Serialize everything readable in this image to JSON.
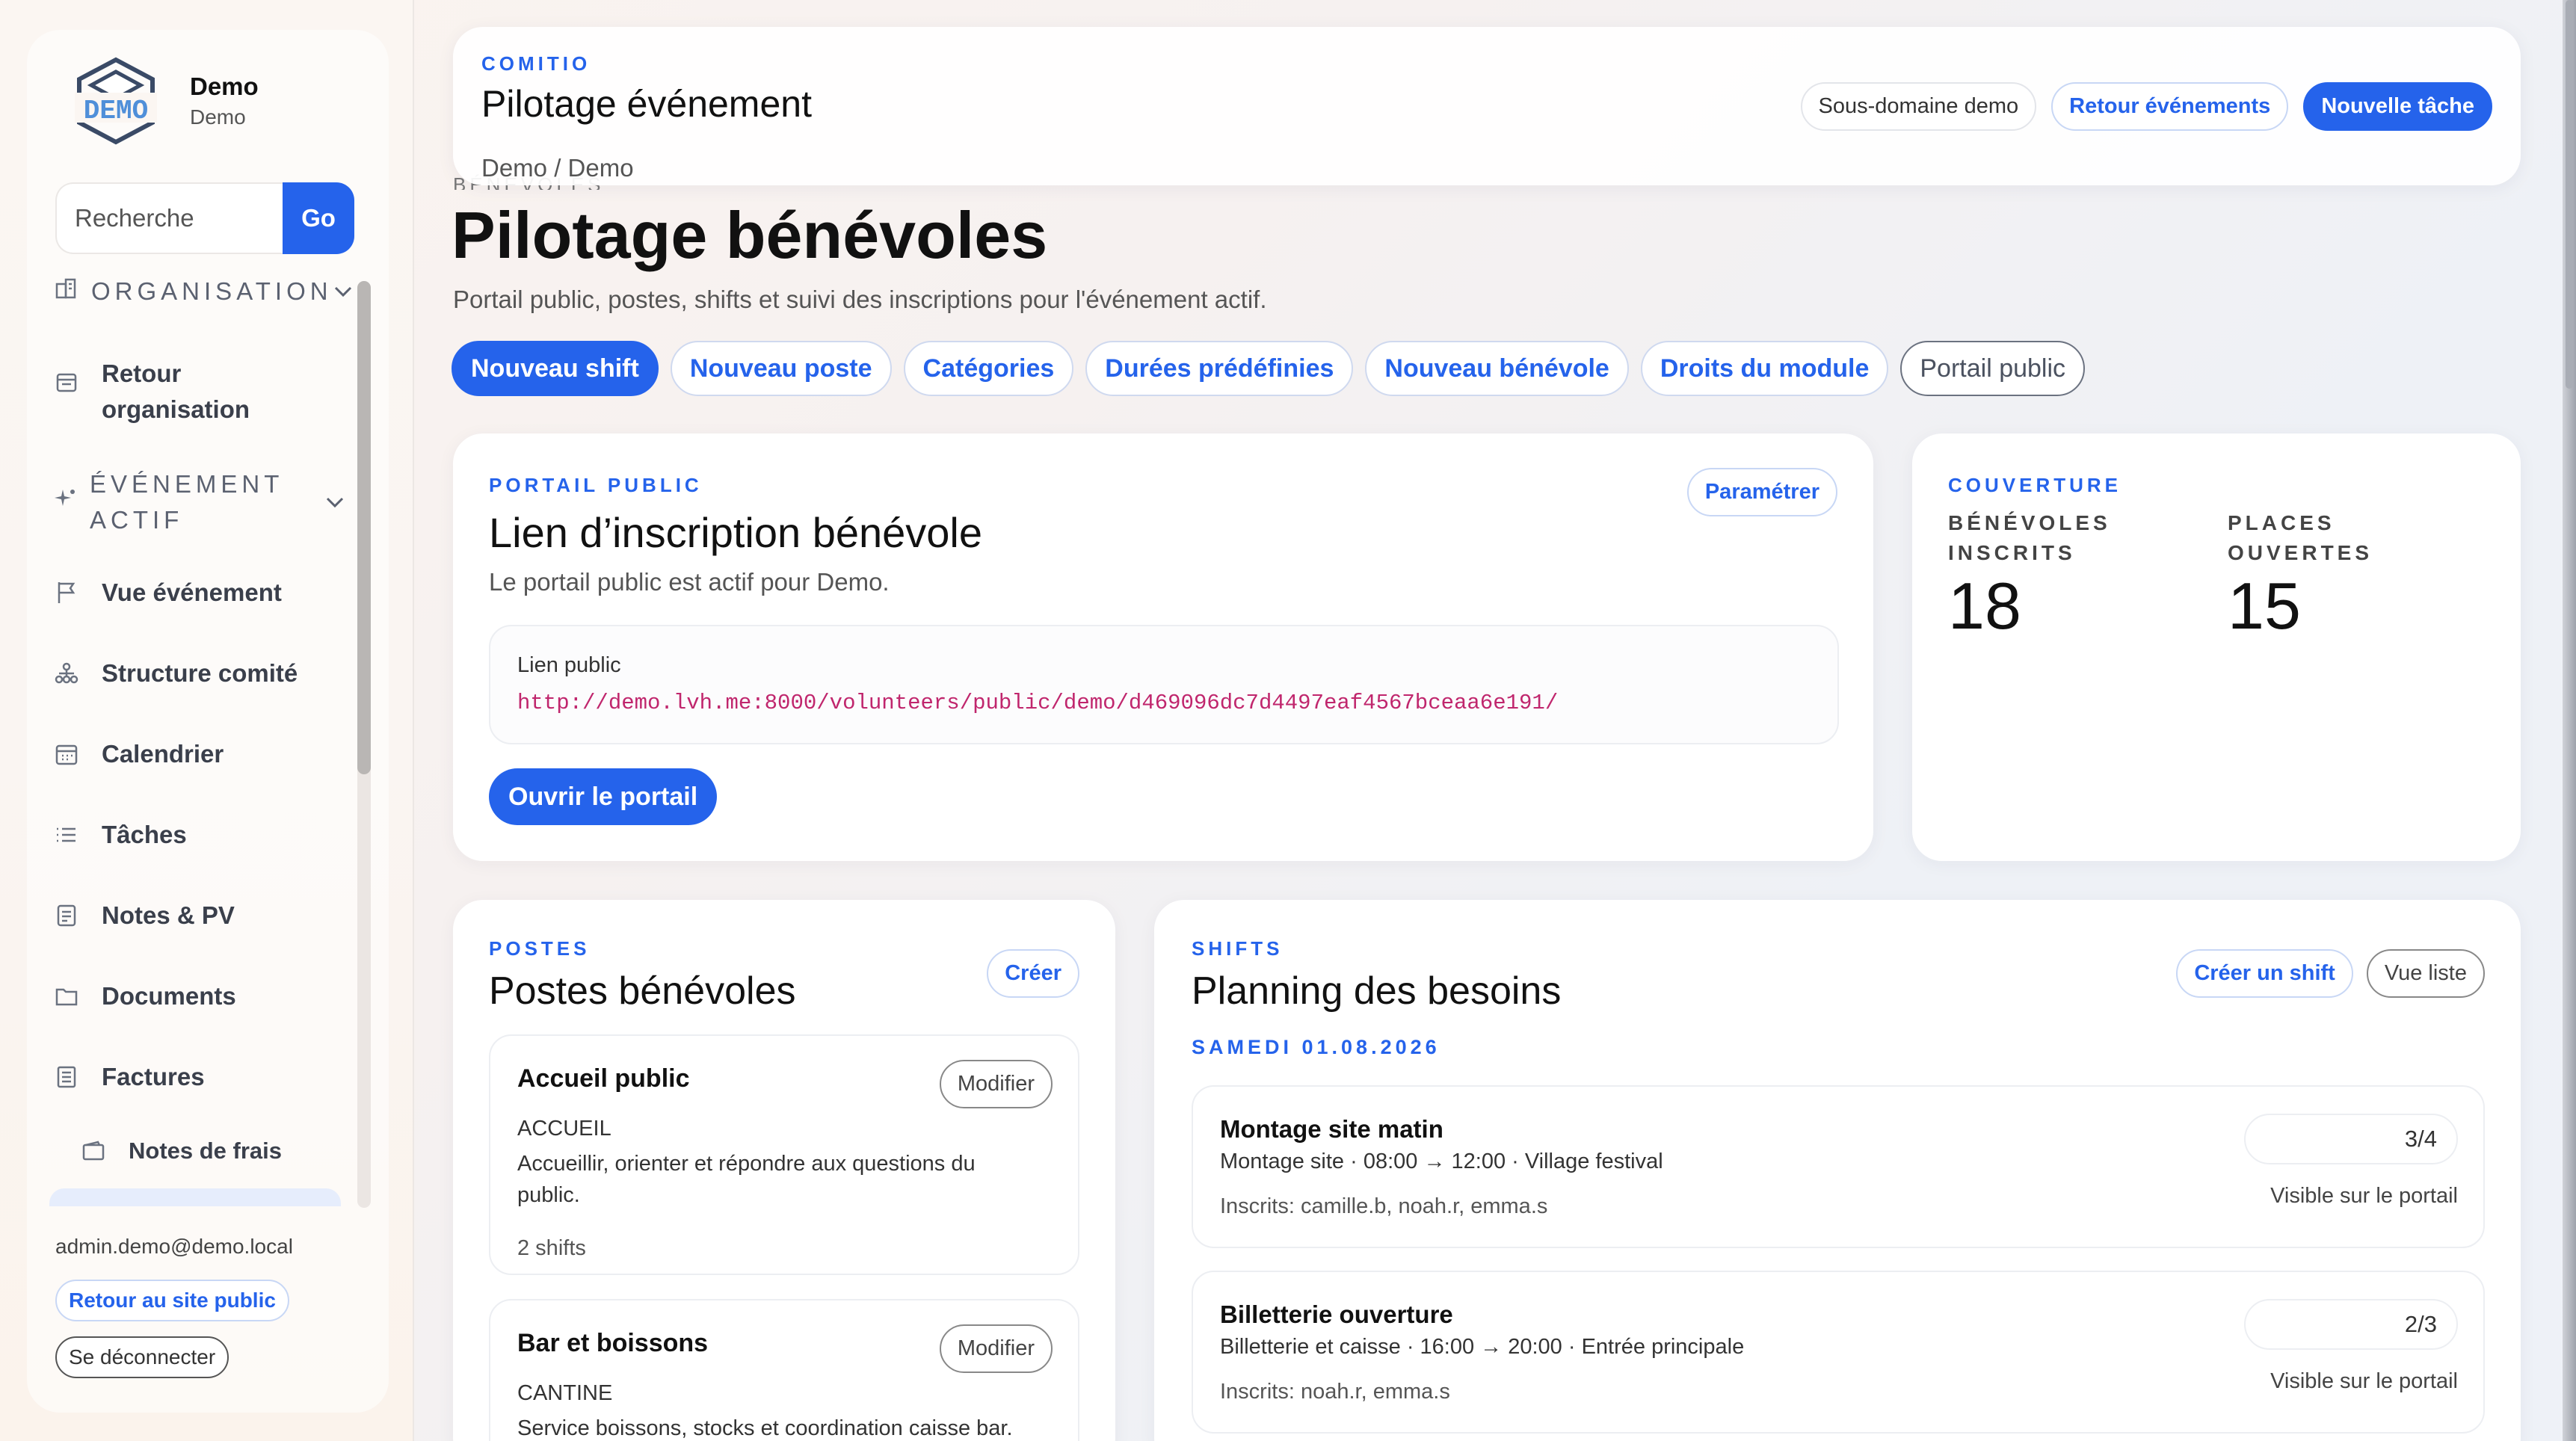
{
  "brand": {
    "name": "Demo",
    "sub": "Demo",
    "logo_text": "DEMO"
  },
  "search": {
    "placeholder": "Recherche",
    "button": "Go"
  },
  "sidebar": {
    "section_org": "ORGANISATION",
    "item_retour": "Retour organisation",
    "section_event": "ÉVÉNEMENT ACTIF",
    "items": [
      {
        "label": "Vue événement",
        "icon": "flag-icon"
      },
      {
        "label": "Structure comité",
        "icon": "org-chart-icon"
      },
      {
        "label": "Calendrier",
        "icon": "calendar-icon"
      },
      {
        "label": "Tâches",
        "icon": "list-icon"
      },
      {
        "label": "Notes & PV",
        "icon": "notes-icon"
      },
      {
        "label": "Documents",
        "icon": "folder-icon"
      },
      {
        "label": "Factures",
        "icon": "invoice-icon"
      }
    ],
    "subitem": "Notes de frais",
    "user_email": "admin.demo@demo.local",
    "back_public": "Retour au site public",
    "logout": "Se déconnecter"
  },
  "header": {
    "eyebrow": "COMITIO",
    "title": "Pilotage événement",
    "crumbs": "Demo / Demo",
    "subdomain": "Sous-domaine demo",
    "back_events": "Retour événements",
    "new_task": "Nouvelle tâche"
  },
  "page": {
    "hidden_eyebrow": "BÉNÉVOLES",
    "title": "Pilotage bénévoles",
    "subtitle": "Portail public, postes, shifts et suivi des inscriptions pour l'événement actif."
  },
  "tabs": {
    "new_shift": "Nouveau shift",
    "new_poste": "Nouveau poste",
    "categories": "Catégories",
    "durations": "Durées prédéfinies",
    "new_volunteer": "Nouveau bénévole",
    "rights": "Droits du module",
    "public_portal": "Portail public"
  },
  "portal": {
    "eyebrow": "PORTAIL PUBLIC",
    "title": "Lien d’inscription bénévole",
    "desc": "Le portail public est actif pour Demo.",
    "configure": "Paramétrer",
    "link_label": "Lien public",
    "link_url": "http://demo.lvh.me:8000/volunteers/public/demo/d469096dc7d4497eaf4567bceaa6e191/",
    "open": "Ouvrir le portail"
  },
  "coverage": {
    "eyebrow": "COUVERTURE",
    "volunteers_label": "BÉNÉVOLES INSCRITS",
    "volunteers_value": "18",
    "places_label": "PLACES OUVERTES",
    "places_value": "15"
  },
  "postes": {
    "eyebrow": "POSTES",
    "title": "Postes bénévoles",
    "create": "Créer",
    "items": [
      {
        "name": "Accueil public",
        "modify": "Modifier",
        "category": "ACCUEIL",
        "desc": "Accueillir, orienter et répondre aux questions du public.",
        "shifts": "2 shifts"
      },
      {
        "name": "Bar et boissons",
        "modify": "Modifier",
        "category": "CANTINE",
        "desc": "Service boissons, stocks et coordination caisse bar."
      }
    ]
  },
  "shifts": {
    "eyebrow": "SHIFTS",
    "title": "Planning des besoins",
    "create": "Créer un shift",
    "list_view": "Vue liste",
    "day": "SAMEDI 01.08.2026",
    "items": [
      {
        "name": "Montage site matin",
        "detail": "Montage site · 08:00 → 12:00 · Village festival",
        "inscrits": "Inscrits: camille.b, noah.r, emma.s",
        "count": "3/4",
        "visible": "Visible sur le portail"
      },
      {
        "name": "Billetterie ouverture",
        "detail": "Billetterie et caisse · 16:00 → 20:00 · Entrée principale",
        "inscrits": "Inscrits: noah.r, emma.s",
        "count": "2/3",
        "visible": "Visible sur le portail"
      }
    ]
  },
  "colors": {
    "accent": "#2563eb",
    "url": "#c0266d"
  }
}
